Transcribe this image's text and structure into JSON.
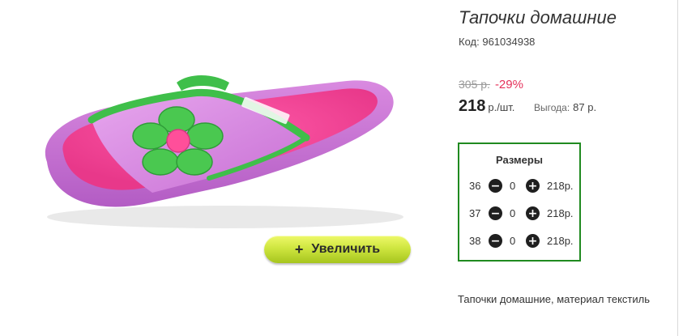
{
  "product": {
    "title": "Тапочки домашние",
    "code_label": "Код:",
    "code_value": "961034938",
    "old_price": "305 р.",
    "discount": "-29%",
    "price": "218",
    "price_unit": "р./шт.",
    "benefit_label": "Выгода:",
    "benefit_value": "87 р.",
    "description": "Тапочки домашние, материал текстиль"
  },
  "image": {
    "zoom_label": "Увеличить",
    "zoom_icon": "+"
  },
  "sizes": {
    "title": "Размеры",
    "minus_icon": "−",
    "plus_icon": "+",
    "rows": [
      {
        "size": "36",
        "qty": "0",
        "price": "218р."
      },
      {
        "size": "37",
        "qty": "0",
        "price": "218р."
      },
      {
        "size": "38",
        "qty": "0",
        "price": "218р."
      }
    ]
  },
  "colors": {
    "sizes_border": "#208a20",
    "discount": "#e5315a",
    "zoom_button": "#cfe640"
  }
}
